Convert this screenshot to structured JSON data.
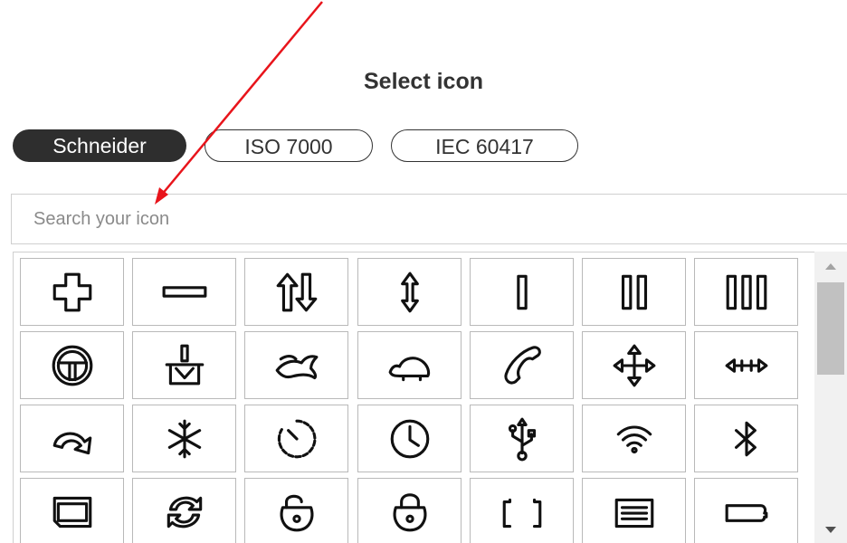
{
  "dialog": {
    "title": "Select icon"
  },
  "tabs": [
    {
      "label": "Schneider",
      "active": true
    },
    {
      "label": "ISO 7000",
      "active": false
    },
    {
      "label": "IEC 60417",
      "active": false
    }
  ],
  "search": {
    "placeholder": "Search your icon",
    "value": ""
  },
  "icons": [
    "plus-icon",
    "minus-icon",
    "arrows-up-down-icon",
    "double-arrow-vertical-icon",
    "one-bar-icon",
    "two-bars-icon",
    "three-bars-icon",
    "steering-wheel-icon",
    "press-icon",
    "hare-fast-icon",
    "tortoise-slow-icon",
    "phone-handset-icon",
    "move-four-way-icon",
    "move-horizontal-icon",
    "curved-arrow-icon",
    "snowflake-icon",
    "timer-dashed-icon",
    "clock-icon",
    "usb-icon",
    "wifi-icon",
    "bluetooth-icon",
    "sd-card-icon",
    "refresh-cycle-icon",
    "unlocked-icon",
    "locked-icon",
    "battery-empty-icon",
    "battery-full-icon",
    "battery-low-icon"
  ],
  "colors": {
    "active_tab_bg": "#2e2e2e",
    "annotation_arrow": "#e8141b",
    "scroll_thumb": "#c1c1c1"
  }
}
